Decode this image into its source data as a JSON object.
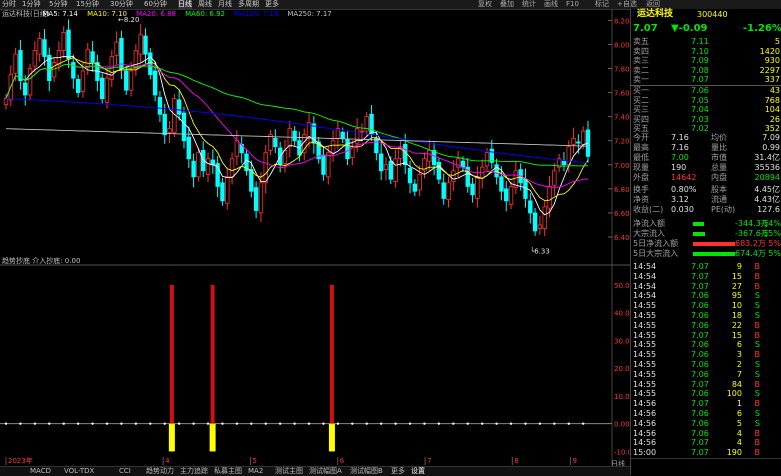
{
  "topbar": {
    "periods": [
      "分时",
      "1分钟",
      "5分钟",
      "15分钟",
      "30分钟",
      "60分钟",
      "日线",
      "周线",
      "月线",
      "多周期",
      "更多"
    ],
    "active_period": "日线",
    "tools": [
      "复权",
      "叠加",
      "统计",
      "画线",
      "F10",
      "标记",
      "+自选",
      "返回"
    ]
  },
  "ma_legend": {
    "stock": "运达科技(日线)",
    "ma5": "MA5: 7.14",
    "ma10": "MA10: 7.10",
    "ma20": "MA20: 6.88",
    "ma60": "MA60: 6.92",
    "ma120": "MA120: 7.16",
    "ma250": "MA250: 7.17"
  },
  "main_chart": {
    "price_axis": [
      "8.20",
      "8.00",
      "7.80",
      "7.60",
      "7.40",
      "7.20",
      "7.00",
      "6.80",
      "6.60",
      "6.40"
    ],
    "high_label": "8.20",
    "low_label": "6.33"
  },
  "indicator": {
    "title": "趋势抄底  介入抄底: 0.00",
    "axis": [
      "50.00",
      "40.00",
      "30.00",
      "20.00",
      "10.00",
      "0.00",
      "-10.00"
    ],
    "date_labels": [
      "2023年",
      "4",
      "5",
      "6",
      "7",
      "8",
      "9"
    ]
  },
  "quote": {
    "name": "运达科技",
    "code": "300440",
    "price": "7.07",
    "change": "▼-0.09",
    "pct": "-1.26%",
    "asks": [
      {
        "label": "卖五",
        "price": "7.11",
        "vol": "5"
      },
      {
        "label": "卖四",
        "price": "7.10",
        "vol": "1420"
      },
      {
        "label": "卖三",
        "price": "7.09",
        "vol": "930"
      },
      {
        "label": "卖二",
        "price": "7.08",
        "vol": "2297"
      },
      {
        "label": "卖一",
        "price": "7.07",
        "vol": "337"
      }
    ],
    "bids": [
      {
        "label": "买一",
        "price": "7.06",
        "vol": "43"
      },
      {
        "label": "买二",
        "price": "7.05",
        "vol": "768"
      },
      {
        "label": "买三",
        "price": "7.04",
        "vol": "104"
      },
      {
        "label": "买四",
        "price": "7.03",
        "vol": "26"
      },
      {
        "label": "买五",
        "price": "7.02",
        "vol": "352"
      }
    ],
    "stats": [
      {
        "l1": "今开",
        "v1": "7.16",
        "l2": "均价",
        "v2": "7.09"
      },
      {
        "l1": "最高",
        "v1": "7.16",
        "l2": "量比",
        "v2": "0.99"
      },
      {
        "l1": "最低",
        "v1": "7.00",
        "l2": "市值",
        "v2": "31.4亿"
      },
      {
        "l1": "现量",
        "v1": "190",
        "l2": "总量",
        "v2": "35536"
      },
      {
        "l1": "外盘",
        "v1": "14642",
        "l2": "内盘",
        "v2": "20894"
      }
    ],
    "fin": [
      {
        "l1": "换手",
        "v1": "0.80%",
        "l2": "股本",
        "v2": "4.45亿"
      },
      {
        "l1": "净资",
        "v1": "3.12",
        "l2": "流通",
        "v2": "4.43亿"
      },
      {
        "l1": "收益(二)",
        "v1": "0.030",
        "l2": "PE(动)",
        "v2": "127.6"
      }
    ],
    "flows": [
      {
        "label": "净流入额",
        "val": "-344.3万",
        "pct": "-14%",
        "color": "#00e600",
        "frac": 0.14
      },
      {
        "label": "大宗流入",
        "val": "-367.6万",
        "pct": "-15%",
        "color": "#00e600",
        "frac": 0.15
      },
      {
        "label": "5日净流入额",
        "val": "683.2万",
        "pct": "5%",
        "color": "#ff3232",
        "frac": 0.95
      },
      {
        "label": "5日大宗流入",
        "val": "674.4万",
        "pct": "5%",
        "color": "#00e600",
        "frac": 0.95
      }
    ],
    "ticks": [
      {
        "t": "14:54",
        "p": "7.07",
        "v": "9",
        "d": "B"
      },
      {
        "t": "14:54",
        "p": "7.07",
        "v": "15",
        "d": "B"
      },
      {
        "t": "14:54",
        "p": "7.07",
        "v": "27",
        "d": "B"
      },
      {
        "t": "14:54",
        "p": "7.06",
        "v": "95",
        "d": "S"
      },
      {
        "t": "14:55",
        "p": "7.06",
        "v": "10",
        "d": "S"
      },
      {
        "t": "14:55",
        "p": "7.06",
        "v": "18",
        "d": "S"
      },
      {
        "t": "14:55",
        "p": "7.06",
        "v": "22",
        "d": "B"
      },
      {
        "t": "14:55",
        "p": "7.07",
        "v": "15",
        "d": "B"
      },
      {
        "t": "14:55",
        "p": "7.06",
        "v": "6",
        "d": "S"
      },
      {
        "t": "14:55",
        "p": "7.06",
        "v": "3",
        "d": "B"
      },
      {
        "t": "14:55",
        "p": "7.06",
        "v": "2",
        "d": "S"
      },
      {
        "t": "14:55",
        "p": "7.06",
        "v": "7",
        "d": "S"
      },
      {
        "t": "14:55",
        "p": "7.07",
        "v": "84",
        "d": "B"
      },
      {
        "t": "14:55",
        "p": "7.06",
        "v": "100",
        "d": "S"
      },
      {
        "t": "14:56",
        "p": "7.07",
        "v": "1",
        "d": "B"
      },
      {
        "t": "14:56",
        "p": "7.06",
        "v": "6",
        "d": "S"
      },
      {
        "t": "14:56",
        "p": "7.06",
        "v": "5",
        "d": "S"
      },
      {
        "t": "14:56",
        "p": "7.06",
        "v": "4",
        "d": "B"
      },
      {
        "t": "14:56",
        "p": "7.07",
        "v": "4",
        "d": "B"
      },
      {
        "t": "15:00",
        "p": "7.07",
        "v": "190",
        "d": "B"
      }
    ],
    "bottom": [
      "日线",
      "笔"
    ]
  },
  "bottom_tabs": [
    "MACD",
    "VOL-TDX",
    "CCI",
    "趋势动力",
    "主力追踪",
    "私募主图",
    "MA2",
    "测试主图",
    "测试幅图A",
    "测试幅图B",
    "更多",
    "设置"
  ],
  "colors": {
    "up": "#ff3232",
    "down": "#00ffff",
    "ma5": "#ffffff",
    "ma10": "#ffff00",
    "ma20": "#ff00ff",
    "ma60": "#00ff00",
    "ma120": "#0000ff",
    "ma250": "#c0c0c0"
  }
}
